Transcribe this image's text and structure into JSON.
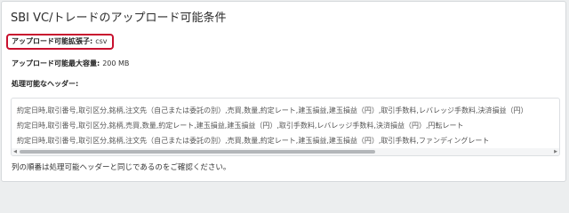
{
  "dialog": {
    "title": "SBI VC/トレードのアップロード可能条件",
    "extension": {
      "label": "アップロード可能拡張子:",
      "value": "csv"
    },
    "max_size": {
      "label": "アップロード可能最大容量:",
      "value": "200 MB"
    },
    "headers": {
      "label": "処理可能なヘッダー:",
      "lines": [
        "約定日時,取引番号,取引区分,銘柄,注文先（自己または委託の別）,売買,数量,約定レート,建玉損益,建玉損益（円）,取引手数料,レバレッジ手数料,決済損益（円）",
        "約定日時,取引番号,取引区分,銘柄,売買,数量,約定レート,建玉損益,建玉損益（円）,取引手数料,レバレッジ手数料,決済損益（円）,円転レート",
        "約定日時,取引番号,取引区分,銘柄,注文先（自己または委託の別）,売買,数量,約定レート,建玉損益,建玉損益（円）,取引手数料,ファンディングレート"
      ]
    },
    "note": "列の順番は処理可能ヘッダーと同じであるのをご確認ください。"
  },
  "colors": {
    "highlight_border": "#c8102e",
    "background": "#eceeef",
    "card": "#ffffff"
  }
}
